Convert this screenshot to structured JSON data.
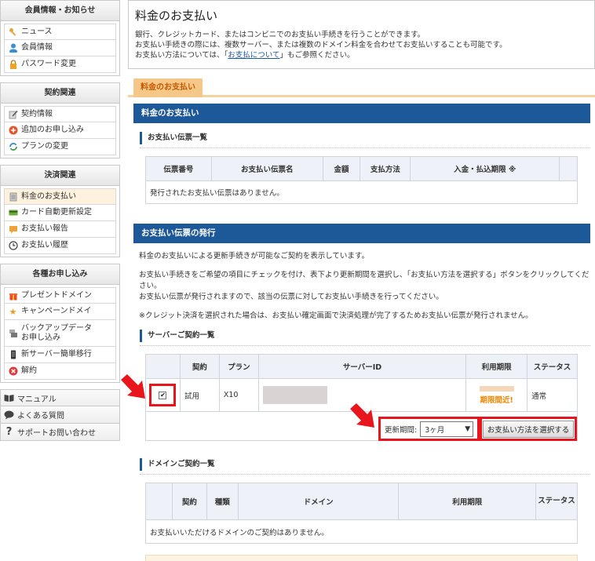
{
  "sidebar": {
    "sections": [
      {
        "title": "会員情報・お知らせ",
        "items": [
          {
            "label": "ニュース",
            "icon": "key-icon"
          },
          {
            "label": "会員情報",
            "icon": "user-icon"
          },
          {
            "label": "パスワード変更",
            "icon": "lock-icon"
          }
        ]
      },
      {
        "title": "契約関連",
        "items": [
          {
            "label": "契約情報",
            "icon": "document-pen-icon"
          },
          {
            "label": "追加のお申し込み",
            "icon": "plus-circle-icon"
          },
          {
            "label": "プランの変更",
            "icon": "refresh-icon"
          }
        ]
      },
      {
        "title": "決済関連",
        "items": [
          {
            "label": "料金のお支払い",
            "icon": "invoice-icon"
          },
          {
            "label": "カード自動更新設定",
            "icon": "credit-card-icon"
          },
          {
            "label": "お支払い報告",
            "icon": "report-icon"
          },
          {
            "label": "お支払い履歴",
            "icon": "clock-icon"
          }
        ]
      },
      {
        "title": "各種お申し込み",
        "items": [
          {
            "label": "プレゼントドメイン",
            "icon": "gift-icon"
          },
          {
            "label": "キャンペーンドメイ",
            "icon": "star-icon"
          },
          {
            "label": "バックアップデータ お申し込み",
            "icon": "server-icon"
          },
          {
            "label": "新サーバー簡単移行",
            "icon": "phone-icon"
          },
          {
            "label": "解約",
            "icon": "cancel-icon"
          }
        ]
      }
    ],
    "links": [
      {
        "label": "マニュアル",
        "icon": "book-icon"
      },
      {
        "label": "よくある質問",
        "icon": "chat-icon"
      },
      {
        "label": "サポートお問い合わせ",
        "icon": "question-icon"
      }
    ]
  },
  "page": {
    "title": "料金のお支払い",
    "intro_line1": "銀行、クレジットカード、またはコンビニでのお支払い手続きを行うことができます。",
    "intro_line2": "お支払い手続きの際には、複数サーバー、または複数のドメイン料金を合わせてお支払いすることも可能です。",
    "intro_line3_pre": "お支払い方法については、「",
    "intro_link": "お支払について",
    "intro_line3_post": "」もご参照ください。",
    "tab": "料金のお支払い"
  },
  "invoices": {
    "bar_title": "料金のお支払い",
    "subhead": "お支払い伝票一覧",
    "columns": [
      "伝票番号",
      "お支払い伝票名",
      "金額",
      "支払方法",
      "入金・払込期限 ※",
      ""
    ],
    "empty": "発行されたお支払い伝票はありません。"
  },
  "issue": {
    "bar_title": "お支払い伝票の発行",
    "desc1": "料金のお支払いによる更新手続きが可能なご契約を表示しています。",
    "desc2a": "お支払い手続きをご希望の項目にチェックを付け、表下より更新期間を選択し、「お支払い方法を選択する」ボタンをクリックしてください。",
    "desc2b": "お支払い伝票が発行されますので、該当の伝票に対してお支払い手続きを行ってください。",
    "desc3": "※クレジット決済を選択された場合は、お支払い確定画面で決済処理が完了するためお支払い伝票が発行されません。"
  },
  "servers": {
    "subhead": "サーバーご契約一覧",
    "columns": [
      "",
      "契約",
      "プラン",
      "サーバーID",
      "利用期限",
      "ステータス"
    ],
    "rows": [
      {
        "checked": "✔",
        "contract": "試用",
        "plan": "X10",
        "expiry_warning": "期限間近!",
        "status": "通常"
      }
    ],
    "renew_label": "更新期間:",
    "renew_value": "3ヶ月",
    "select_arrow": "▼",
    "pay_button": "お支払い方法を選択する"
  },
  "domains": {
    "subhead": "ドメインご契約一覧",
    "columns": [
      "",
      "契約",
      "種類",
      "ドメイン",
      "利用期限",
      "ステータス"
    ],
    "empty": "お支払いいただけるドメインのご契約はありません。"
  },
  "colors": {
    "accent_blue": "#1d5898",
    "highlight_red": "#e8151c",
    "tab_orange": "#f5c788",
    "warn_orange": "#ef8700"
  }
}
